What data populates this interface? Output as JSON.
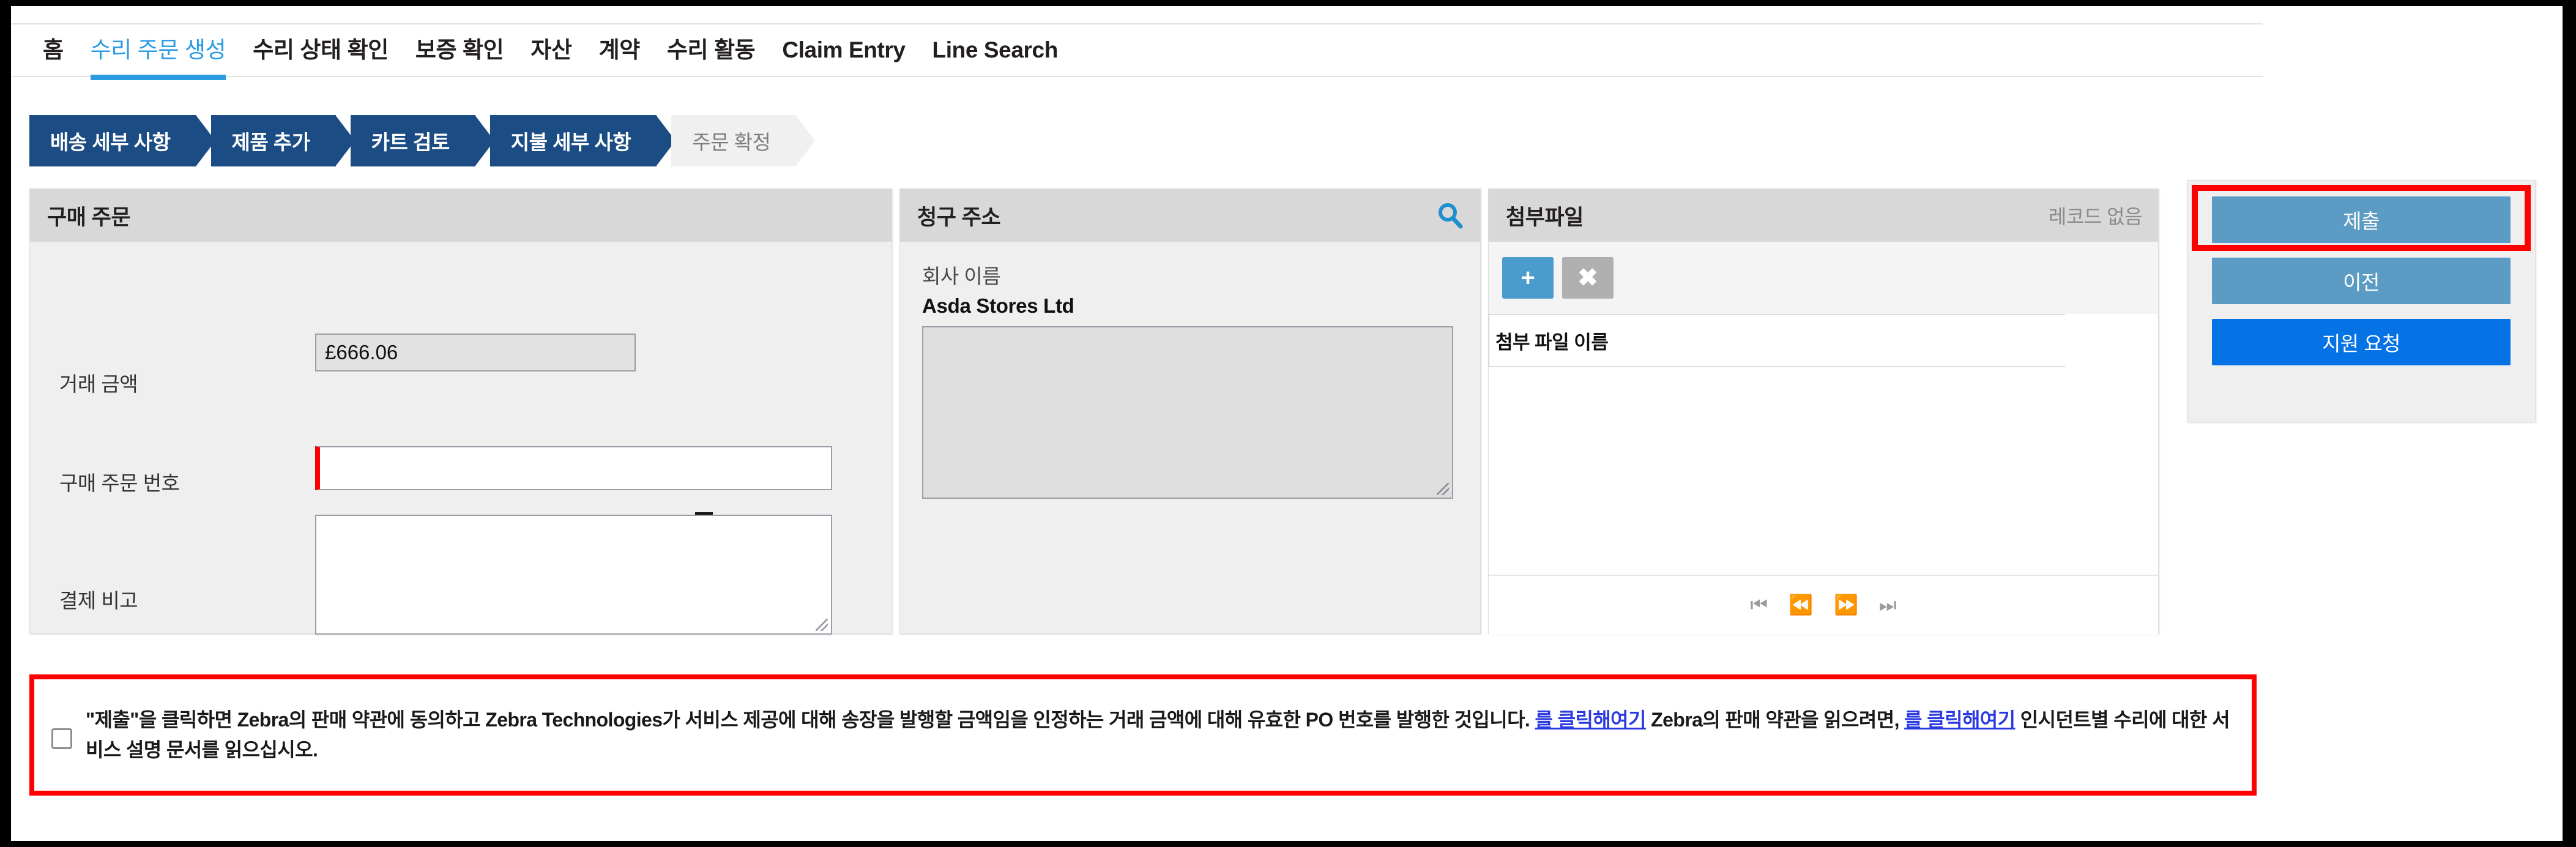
{
  "nav": {
    "tabs": [
      {
        "label": "홈",
        "active": false
      },
      {
        "label": "수리 주문 생성",
        "active": true
      },
      {
        "label": "수리 상태 확인",
        "active": false
      },
      {
        "label": "보증 확인",
        "active": false
      },
      {
        "label": "자산",
        "active": false
      },
      {
        "label": "계약",
        "active": false
      },
      {
        "label": "수리 활동",
        "active": false
      },
      {
        "label": "Claim Entry",
        "active": false
      },
      {
        "label": "Line Search",
        "active": false
      }
    ]
  },
  "steps": [
    {
      "label": "배송 세부 사항",
      "state": "done"
    },
    {
      "label": "제품 추가",
      "state": "done"
    },
    {
      "label": "카트 검토",
      "state": "done"
    },
    {
      "label": "지불 세부 사항",
      "state": "current"
    },
    {
      "label": "주문 확정",
      "state": "inactive"
    }
  ],
  "purchase_order": {
    "title": "구매 주문",
    "amount_label": "거래 금액",
    "amount_value": "£666.06",
    "po_number_label": "구매 주문 번호",
    "po_number_value": "",
    "po_number_placeholder": "",
    "notes_label": "결제 비고",
    "notes_value": "",
    "notes_placeholder": "",
    "doc_icon": "document-icon"
  },
  "billing_address": {
    "title": "청구 주소",
    "search_icon": "search-icon",
    "company_label": "회사 이름",
    "company_value": "Asda Stores Ltd",
    "address_value": ""
  },
  "attachments": {
    "title": "첨부파일",
    "status": "레코드 없음",
    "add_label": "+",
    "delete_label": "✖",
    "column_header": "첨부 파일 이름",
    "rows": [],
    "pager": [
      {
        "icon": "first-page-icon",
        "glyph": "⏮"
      },
      {
        "icon": "prev-page-icon",
        "glyph": "⏪"
      },
      {
        "icon": "next-page-icon",
        "glyph": "⏩"
      },
      {
        "icon": "last-page-icon",
        "glyph": "⏭"
      }
    ]
  },
  "actions": {
    "submit_label": "제출",
    "previous_label": "이전",
    "help_label": "지원 요청"
  },
  "consent": {
    "checked": false,
    "part1": "\"제출\"을 클릭하면 Zebra의 판매 약관에 동의하고 Zebra Technologies가 서비스 제공에 대해 송장을 발행할 금액임을 인정하는 거래 금액에 대해 유효한 PO 번호를 발행한 것입니다. ",
    "link1": "를 클릭해여기",
    "part2": " Zebra의 판매 약관을 읽으려면, ",
    "link2": "를 클릭해여기",
    "part3": " 인시던트별 수리에 대한 서비스 설명 문서를 읽으십시오."
  },
  "colors": {
    "accent_blue": "#2b9be2",
    "step_blue": "#1b4d84",
    "button_blue": "#5b9bc4",
    "help_blue": "#0572e6",
    "highlight_red": "#ff0000",
    "link_blue": "#2b3ae0"
  }
}
